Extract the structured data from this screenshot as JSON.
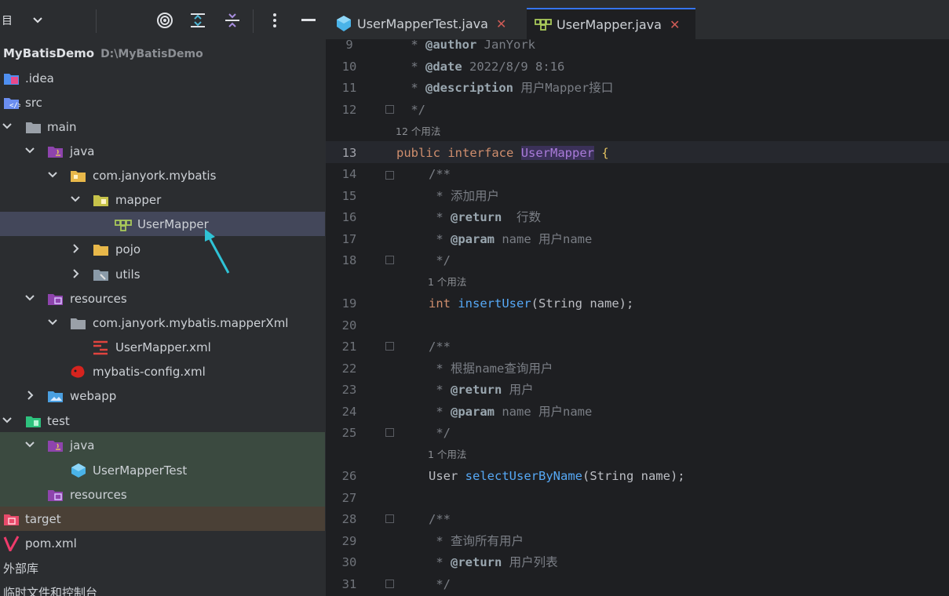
{
  "project_panel": {
    "header_label": "目",
    "tree": [
      {
        "label": "MyBatisDemo",
        "hint": "D:\\MyBatisDemo",
        "icon": "module-icon"
      },
      {
        "label": ".idea",
        "icon": "idea-folder-icon"
      },
      {
        "label": "src",
        "icon": "source-folder-icon"
      },
      {
        "label": "main",
        "icon": "folder-icon"
      },
      {
        "label": "java",
        "icon": "java-source-root-icon"
      },
      {
        "label": "com.janyork.mybatis",
        "icon": "package-icon"
      },
      {
        "label": "mapper",
        "icon": "package-icon"
      },
      {
        "label": "UserMapper",
        "icon": "interface-icon"
      },
      {
        "label": "pojo",
        "icon": "package-icon"
      },
      {
        "label": "utils",
        "icon": "package-icon"
      },
      {
        "label": "resources",
        "icon": "resources-root-icon"
      },
      {
        "label": "com.janyork.mybatis.mapperXml",
        "icon": "folder-icon"
      },
      {
        "label": "UserMapper.xml",
        "icon": "xml-file-icon"
      },
      {
        "label": "mybatis-config.xml",
        "icon": "mybatis-config-icon"
      },
      {
        "label": "webapp",
        "icon": "web-folder-icon"
      },
      {
        "label": "test",
        "icon": "test-folder-icon"
      },
      {
        "label": "java",
        "icon": "java-test-root-icon"
      },
      {
        "label": "UserMapperTest",
        "icon": "class-icon"
      },
      {
        "label": "resources",
        "icon": "resources-root-icon"
      },
      {
        "label": "target",
        "icon": "excluded-folder-icon"
      },
      {
        "label": "pom.xml",
        "icon": "maven-icon"
      },
      {
        "label": "外部库",
        "icon": ""
      },
      {
        "label": "临时文件和控制台",
        "icon": ""
      }
    ]
  },
  "editor": {
    "tabs": [
      {
        "label": "UserMapperTest.java",
        "icon": "class-icon",
        "active": false
      },
      {
        "label": "UserMapper.java",
        "icon": "interface-icon",
        "active": true
      }
    ],
    "line_numbers": [
      "9",
      "10",
      "11",
      "12",
      "13",
      "14",
      "15",
      "16",
      "17",
      "18",
      "19",
      "20",
      "21",
      "22",
      "23",
      "24",
      "25",
      "26",
      "27",
      "28",
      "29",
      "30",
      "31"
    ],
    "usages": {
      "u12": "12 个用法",
      "u1a": "1 个用法",
      "u1b": "1 个用法"
    },
    "code": {
      "l9_tag": "@author",
      "l9_rest": " JanYork",
      "l10_tag": "@date",
      "l10_rest": " 2022/8/9 8:16",
      "l11_tag": "@description",
      "l11_rest": " 用户Mapper接口",
      "l12": " */",
      "l13_kw1": "public",
      "l13_kw2": "interface",
      "l13_name": "UserMapper",
      "l13_brace": " {",
      "l14": "/**",
      "l15": " * 添加用户",
      "l16_tag": "@return",
      "l16_rest": "  行数",
      "l17_tag": "@param",
      "l17_name": " name",
      "l17_rest": " 用户name",
      "l18": " */",
      "l19_type": "int",
      "l19_fn": "insertUser",
      "l19_args": "(String name);",
      "l21": "/**",
      "l22": " * 根据name查询用户",
      "l23_tag": "@return",
      "l23_rest": " 用户",
      "l24_tag": "@param",
      "l24_name": " name",
      "l24_rest": " 用户name",
      "l25": " */",
      "l26_type": "User",
      "l26_fn": "selectUserByName",
      "l26_args": "(String name);",
      "l28": "/**",
      "l29": " * 查询所有用户",
      "l30_tag": "@return",
      "l30_rest": " 用户列表",
      "l31": " */",
      "star": " * "
    }
  },
  "colors": {
    "accent": "#3574f0",
    "selected_row": "#43475a",
    "keyword": "#cf8e6d",
    "function": "#56a8f5"
  }
}
